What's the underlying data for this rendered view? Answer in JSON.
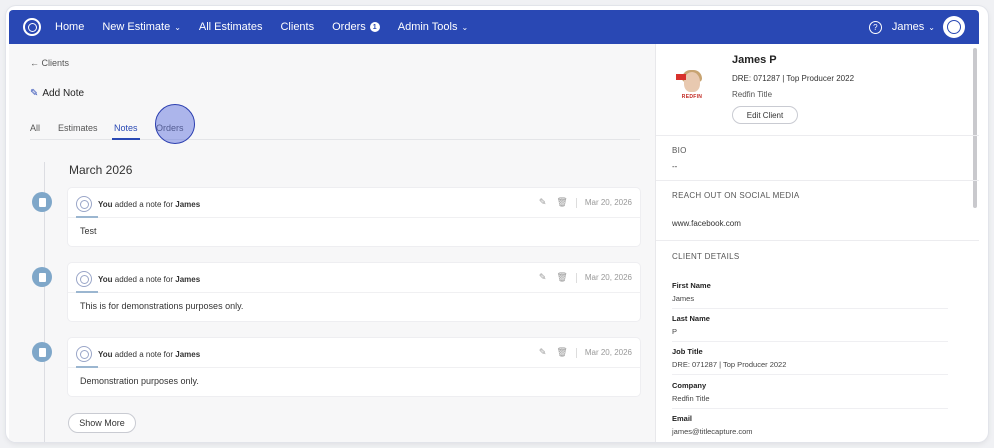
{
  "nav": {
    "items": [
      {
        "label": "Home"
      },
      {
        "label": "New Estimate",
        "chevron": true
      },
      {
        "label": "All Estimates"
      },
      {
        "label": "Clients"
      },
      {
        "label": "Orders",
        "badge": "1"
      },
      {
        "label": "Admin Tools",
        "chevron": true
      }
    ],
    "help": "?",
    "user": "James",
    "color": "#2948b4"
  },
  "left": {
    "back": "← Clients",
    "add_note": "Add Note",
    "tabs": [
      "All",
      "Estimates",
      "Notes",
      "Orders"
    ],
    "active_tab": "Notes",
    "month": "March 2026",
    "notes": [
      {
        "prefix": "You",
        "text": "added a note for",
        "name": "James",
        "date": "Mar 20, 2026",
        "body": "Test"
      },
      {
        "prefix": "You",
        "text": "added a note for",
        "name": "James",
        "date": "Mar 20, 2026",
        "body": "This is for demonstrations purposes only."
      },
      {
        "prefix": "You",
        "text": "added a note for",
        "name": "James",
        "date": "Mar 20, 2026",
        "body": "Demonstration purposes only."
      }
    ],
    "show_more": "Show More"
  },
  "right": {
    "brand": "REDFIN",
    "name": "James P",
    "dre": "DRE: 071287 | Top Producer 2022",
    "company": "Redfin Title",
    "edit": "Edit Client",
    "bio_label": "BIO",
    "bio_value": "--",
    "social_label": "REACH OUT ON SOCIAL MEDIA",
    "social_value": "www.facebook.com",
    "details_label": "CLIENT DETAILS",
    "fields": [
      {
        "label": "First Name",
        "value": "James"
      },
      {
        "label": "Last Name",
        "value": "P"
      },
      {
        "label": "Job Title",
        "value": "DRE: 071287 | Top Producer 2022"
      },
      {
        "label": "Company",
        "value": "Redfin Title"
      },
      {
        "label": "Email",
        "value": "james@titlecapture.com"
      }
    ]
  }
}
